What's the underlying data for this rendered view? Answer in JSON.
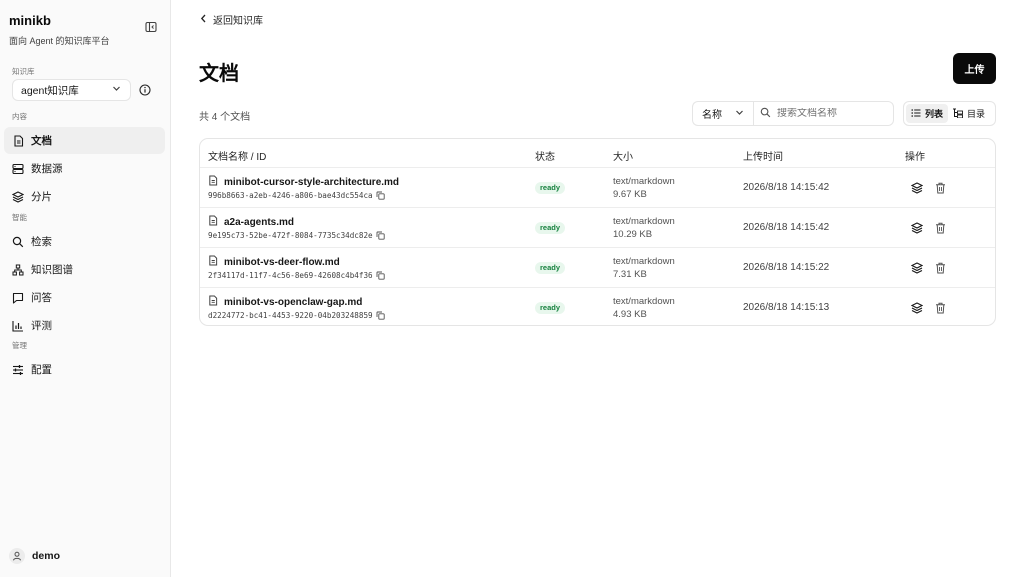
{
  "brand": {
    "name": "minikb",
    "subtitle": "面向 Agent 的知识库平台"
  },
  "sidebar": {
    "kb_group_label": "知识库",
    "kb_selected": "agent知识库",
    "groups": [
      {
        "label": "内容",
        "items": [
          {
            "label": "文档",
            "icon": "file-icon",
            "active": true
          },
          {
            "label": "数据源",
            "icon": "database-icon"
          },
          {
            "label": "分片",
            "icon": "layers-icon"
          }
        ]
      },
      {
        "label": "智能",
        "items": [
          {
            "label": "检索",
            "icon": "search-icon"
          },
          {
            "label": "知识图谱",
            "icon": "graph-icon"
          },
          {
            "label": "问答",
            "icon": "chat-icon"
          },
          {
            "label": "评测",
            "icon": "chart-icon"
          }
        ]
      },
      {
        "label": "管理",
        "items": [
          {
            "label": "配置",
            "icon": "sliders-icon"
          }
        ]
      }
    ],
    "user": "demo"
  },
  "main": {
    "back_label": "返回知识库",
    "title": "文档",
    "upload_label": "上传",
    "count_label": "共 4 个文档",
    "sort_selected": "名称",
    "search_placeholder": "搜索文档名称",
    "view_list_label": "列表",
    "view_tree_label": "目录",
    "table": {
      "headers": [
        "文档名称 / ID",
        "状态",
        "大小",
        "上传时间",
        "操作"
      ],
      "rows": [
        {
          "name": "minibot-cursor-style-architecture.md",
          "id": "996b8663-a2eb-4246-a806-bae43dc554ca",
          "status": "ready",
          "mime": "text/markdown",
          "size": "9.67 KB",
          "uploaded": "2026/8/18 14:15:42"
        },
        {
          "name": "a2a-agents.md",
          "id": "9e195c73-52be-472f-8084-7735c34dc82e",
          "status": "ready",
          "mime": "text/markdown",
          "size": "10.29 KB",
          "uploaded": "2026/8/18 14:15:42"
        },
        {
          "name": "minibot-vs-deer-flow.md",
          "id": "2f34117d-11f7-4c56-8e69-42608c4b4f36",
          "status": "ready",
          "mime": "text/markdown",
          "size": "7.31 KB",
          "uploaded": "2026/8/18 14:15:22"
        },
        {
          "name": "minibot-vs-openclaw-gap.md",
          "id": "d2224772-bc41-4453-9220-04b203248859",
          "status": "ready",
          "mime": "text/markdown",
          "size": "4.93 KB",
          "uploaded": "2026/8/18 14:15:13"
        }
      ]
    }
  },
  "colors": {
    "primary": "#0a0a0a",
    "ready_bg": "#e8f7ed",
    "ready_text": "#15803d",
    "sidebar_bg": "#fafafa"
  }
}
